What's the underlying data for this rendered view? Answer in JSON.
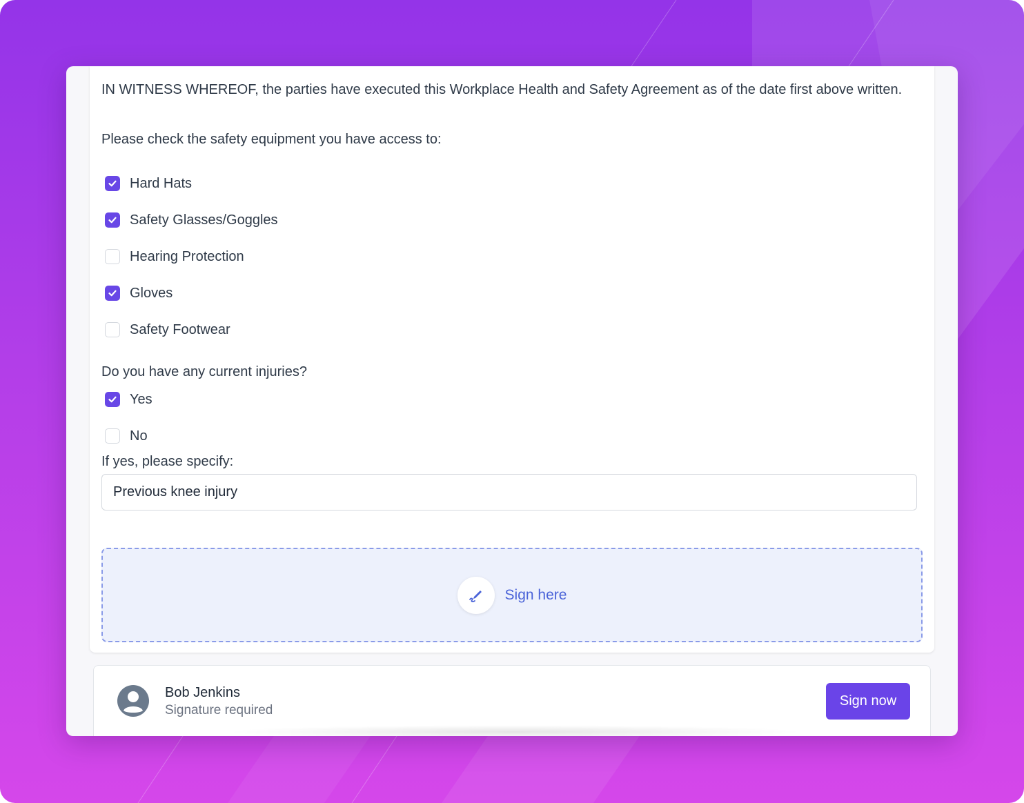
{
  "agreement": {
    "witness_text": "IN WITNESS WHEREOF, the parties have executed this Workplace Health and Safety Agreement as of the date first above written."
  },
  "equipment": {
    "question": "Please check the safety equipment you have access to:",
    "items": [
      {
        "label": "Hard Hats",
        "checked": true
      },
      {
        "label": "Safety Glasses/Goggles",
        "checked": true
      },
      {
        "label": "Hearing Protection",
        "checked": false
      },
      {
        "label": "Gloves",
        "checked": true
      },
      {
        "label": "Safety Footwear",
        "checked": false
      }
    ]
  },
  "injuries": {
    "question": "Do you have any current injuries?",
    "options": [
      {
        "label": "Yes",
        "checked": true
      },
      {
        "label": "No",
        "checked": false
      }
    ],
    "specify_label": "If yes, please specify:",
    "specify_value": "Previous knee injury"
  },
  "signature": {
    "prompt": "Sign here",
    "icon": "pen-icon"
  },
  "signer": {
    "name": "Bob Jenkins",
    "status": "Signature required",
    "button_label": "Sign now",
    "icon": "user-avatar-icon"
  },
  "colors": {
    "accent": "#6a44e8",
    "checkbox_checked": "#6847e6",
    "sign_link": "#4a63d8",
    "sign_zone_bg": "#edf1fc",
    "sign_zone_border": "#8a9be8",
    "avatar": "#6b7a8c"
  }
}
